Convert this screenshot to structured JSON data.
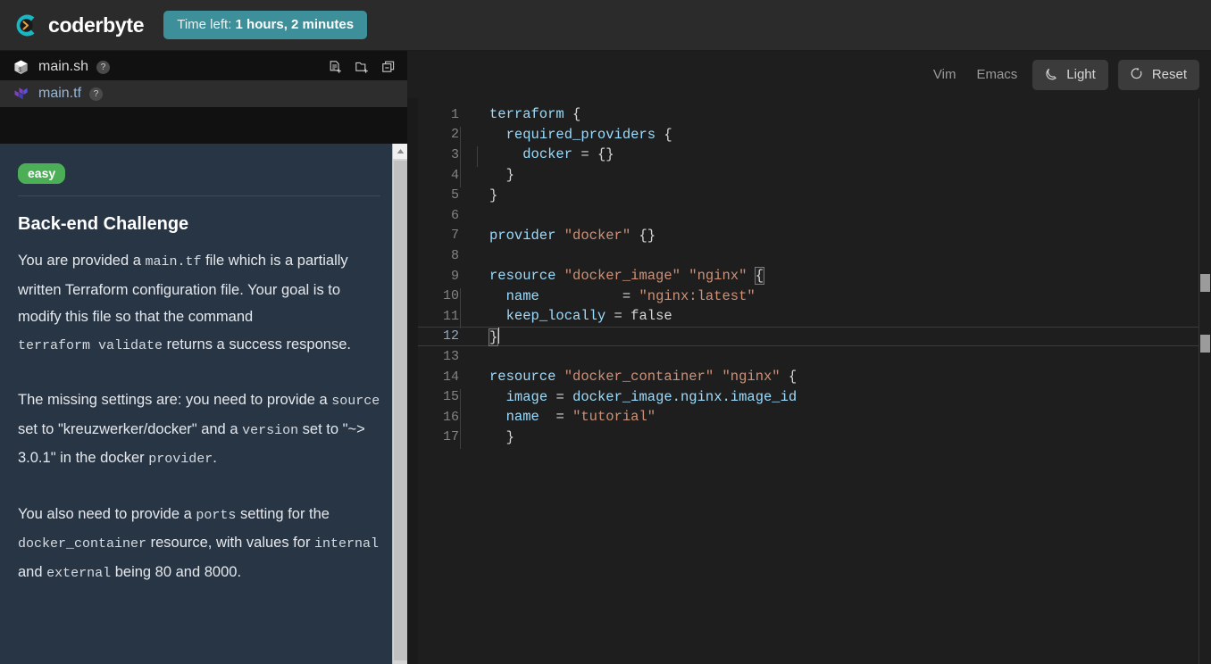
{
  "header": {
    "brand": "coderbyte",
    "logo_icon": "coderbyte-logo-icon",
    "timer_label": "Time left:",
    "timer_value": "1 hours, 2 minutes",
    "timer_bg": "#3d8f99"
  },
  "files": {
    "items": [
      {
        "name": "main.sh",
        "icon": "shell-file-icon",
        "help": "?",
        "active": false
      },
      {
        "name": "main.tf",
        "icon": "terraform-file-icon",
        "help": "?",
        "active": true
      }
    ],
    "actions": [
      {
        "name": "new-file-icon",
        "title": "New File"
      },
      {
        "name": "new-folder-icon",
        "title": "New Folder"
      },
      {
        "name": "collapse-folders-icon",
        "title": "Collapse Folders"
      }
    ]
  },
  "description": {
    "difficulty": "easy",
    "difficulty_color": "#4caf58",
    "title": "Back-end Challenge",
    "paragraphs": [
      {
        "parts": [
          {
            "t": "You are provided a ",
            "mono": false
          },
          {
            "t": "main.tf",
            "mono": true
          },
          {
            "t": " file which is a partially written Terraform configuration file. Your goal is to modify this file so that the command ",
            "mono": false
          },
          {
            "t": "terraform validate",
            "mono": true
          },
          {
            "t": " returns a success response.",
            "mono": false
          }
        ]
      },
      {
        "parts": [
          {
            "t": "The missing settings are: you need to provide a ",
            "mono": false
          },
          {
            "t": "source",
            "mono": true
          },
          {
            "t": " set to \"kreuzwerker/docker\" and a ",
            "mono": false
          },
          {
            "t": "version",
            "mono": true
          },
          {
            "t": " set to \"~> 3.0.1\" in the docker ",
            "mono": false
          },
          {
            "t": "provider",
            "mono": true
          },
          {
            "t": ".",
            "mono": false
          }
        ]
      },
      {
        "parts": [
          {
            "t": "You also need to provide a ",
            "mono": false
          },
          {
            "t": "ports",
            "mono": true
          },
          {
            "t": " setting for the ",
            "mono": false
          },
          {
            "t": "docker_container",
            "mono": true
          },
          {
            "t": " resource, with values for ",
            "mono": false
          },
          {
            "t": "internal",
            "mono": true
          },
          {
            "t": " and ",
            "mono": false
          },
          {
            "t": "external",
            "mono": true
          },
          {
            "t": " being 80 and 8000.",
            "mono": false
          }
        ]
      }
    ]
  },
  "editor": {
    "toolbar": {
      "vim": "Vim",
      "emacs": "Emacs",
      "theme_label": "Light",
      "theme_icon": "moon-icon",
      "reset_label": "Reset",
      "reset_icon": "reset-icon"
    },
    "active_line": 12,
    "lines": [
      {
        "n": 1,
        "tokens": [
          {
            "c": "kw",
            "t": "terraform"
          },
          {
            "c": "plain",
            "t": " "
          },
          {
            "c": "brace",
            "t": "{"
          }
        ],
        "indent": 0
      },
      {
        "n": 2,
        "tokens": [
          {
            "c": "plain",
            "t": "  "
          },
          {
            "c": "kw",
            "t": "required_providers"
          },
          {
            "c": "plain",
            "t": " "
          },
          {
            "c": "brace",
            "t": "{"
          }
        ],
        "indent": 1
      },
      {
        "n": 3,
        "tokens": [
          {
            "c": "plain",
            "t": "    "
          },
          {
            "c": "kw",
            "t": "docker"
          },
          {
            "c": "plain",
            "t": " "
          },
          {
            "c": "punct",
            "t": "="
          },
          {
            "c": "plain",
            "t": " "
          },
          {
            "c": "brace",
            "t": "{}"
          }
        ],
        "indent": 2
      },
      {
        "n": 4,
        "tokens": [
          {
            "c": "plain",
            "t": "  "
          },
          {
            "c": "brace",
            "t": "}"
          }
        ],
        "indent": 1
      },
      {
        "n": 5,
        "tokens": [
          {
            "c": "brace",
            "t": "}"
          }
        ],
        "indent": 0
      },
      {
        "n": 6,
        "tokens": [],
        "indent": 0
      },
      {
        "n": 7,
        "tokens": [
          {
            "c": "kw",
            "t": "provider"
          },
          {
            "c": "plain",
            "t": " "
          },
          {
            "c": "str",
            "t": "\"docker\""
          },
          {
            "c": "plain",
            "t": " "
          },
          {
            "c": "brace",
            "t": "{}"
          }
        ],
        "indent": 0
      },
      {
        "n": 8,
        "tokens": [],
        "indent": 0
      },
      {
        "n": 9,
        "tokens": [
          {
            "c": "kw",
            "t": "resource"
          },
          {
            "c": "plain",
            "t": " "
          },
          {
            "c": "str",
            "t": "\"docker_image\""
          },
          {
            "c": "plain",
            "t": " "
          },
          {
            "c": "str",
            "t": "\"nginx\""
          },
          {
            "c": "plain",
            "t": " "
          },
          {
            "c": "brace",
            "t": "{",
            "match": true
          }
        ],
        "indent": 0
      },
      {
        "n": 10,
        "tokens": [
          {
            "c": "plain",
            "t": "  "
          },
          {
            "c": "kw",
            "t": "name"
          },
          {
            "c": "plain",
            "t": "          "
          },
          {
            "c": "punct",
            "t": "="
          },
          {
            "c": "plain",
            "t": " "
          },
          {
            "c": "str",
            "t": "\"nginx:latest\""
          }
        ],
        "indent": 1
      },
      {
        "n": 11,
        "tokens": [
          {
            "c": "plain",
            "t": "  "
          },
          {
            "c": "kw",
            "t": "keep_locally"
          },
          {
            "c": "plain",
            "t": " "
          },
          {
            "c": "punct",
            "t": "="
          },
          {
            "c": "plain",
            "t": " "
          },
          {
            "c": "bool",
            "t": "false"
          }
        ],
        "indent": 1
      },
      {
        "n": 12,
        "tokens": [
          {
            "c": "brace",
            "t": "}",
            "match": true,
            "caret": true
          }
        ],
        "indent": 0
      },
      {
        "n": 13,
        "tokens": [],
        "indent": 0
      },
      {
        "n": 14,
        "tokens": [
          {
            "c": "kw",
            "t": "resource"
          },
          {
            "c": "plain",
            "t": " "
          },
          {
            "c": "str",
            "t": "\"docker_container\""
          },
          {
            "c": "plain",
            "t": " "
          },
          {
            "c": "str",
            "t": "\"nginx\""
          },
          {
            "c": "plain",
            "t": " "
          },
          {
            "c": "brace",
            "t": "{"
          }
        ],
        "indent": 0
      },
      {
        "n": 15,
        "tokens": [
          {
            "c": "plain",
            "t": "  "
          },
          {
            "c": "kw",
            "t": "image"
          },
          {
            "c": "plain",
            "t": " "
          },
          {
            "c": "punct",
            "t": "="
          },
          {
            "c": "plain",
            "t": " "
          },
          {
            "c": "kw",
            "t": "docker_image.nginx.image_id"
          }
        ],
        "indent": 1
      },
      {
        "n": 16,
        "tokens": [
          {
            "c": "plain",
            "t": "  "
          },
          {
            "c": "kw",
            "t": "name"
          },
          {
            "c": "plain",
            "t": "  "
          },
          {
            "c": "punct",
            "t": "="
          },
          {
            "c": "plain",
            "t": " "
          },
          {
            "c": "str",
            "t": "\"tutorial\""
          }
        ],
        "indent": 1
      },
      {
        "n": 17,
        "tokens": [
          {
            "c": "plain",
            "t": "  "
          },
          {
            "c": "brace",
            "t": "}"
          }
        ],
        "indent": 1
      }
    ]
  }
}
